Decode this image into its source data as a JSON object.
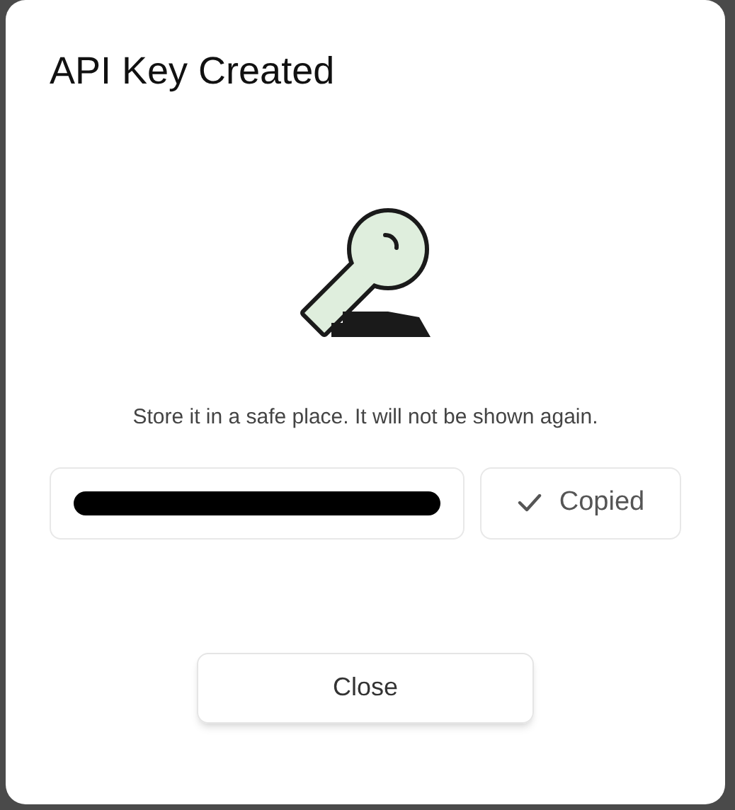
{
  "dialog": {
    "title": "API Key Created",
    "message": "Store it in a safe place. It will not be shown again.",
    "key_field": {
      "redacted": true
    },
    "copy_button": {
      "label": "Copied",
      "copied": true
    },
    "close_button": {
      "label": "Close"
    }
  }
}
